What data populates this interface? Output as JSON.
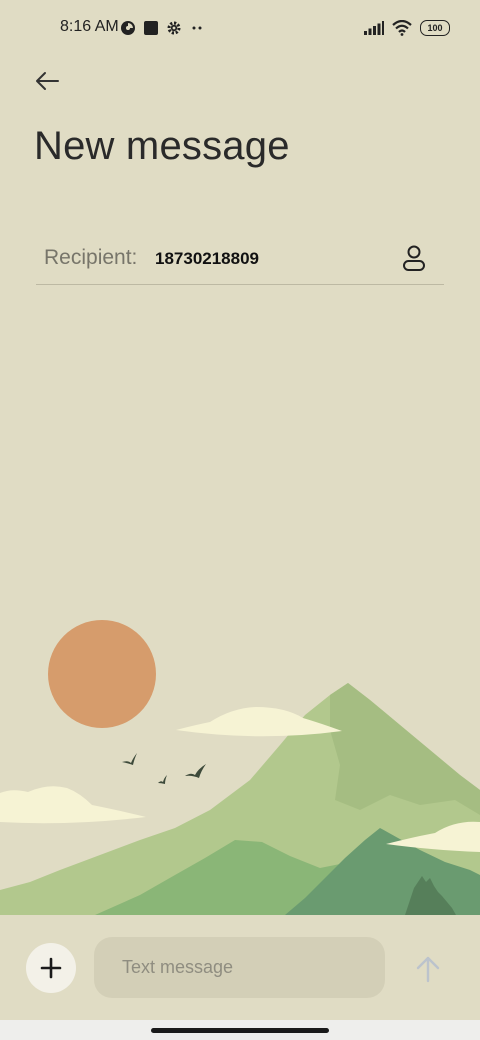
{
  "status_bar": {
    "time": "8:16 AM",
    "left_icons": [
      "data-saver-icon",
      "square-notification-icon",
      "settings-icon",
      "more-dots-icon"
    ],
    "right_icons": [
      "signal-icon",
      "wifi-icon",
      "battery-icon"
    ],
    "battery": "100"
  },
  "header": {
    "back_icon": "arrow-left-icon",
    "title": "New message"
  },
  "recipient": {
    "label": "Recipient:",
    "value": "18730218809",
    "contact_icon": "person-icon"
  },
  "composer": {
    "add_icon": "plus-icon",
    "placeholder": "Text message",
    "send_icon": "arrow-up-icon"
  },
  "colors": {
    "background": "#e0dcc4",
    "input_bg": "#d3cfb7",
    "sun": "#d69c6c",
    "mountain_light": "#b2c88d",
    "mountain_mid": "#8ab677",
    "mountain_dark": "#6a9b70",
    "cloud": "#f6f3d4"
  }
}
